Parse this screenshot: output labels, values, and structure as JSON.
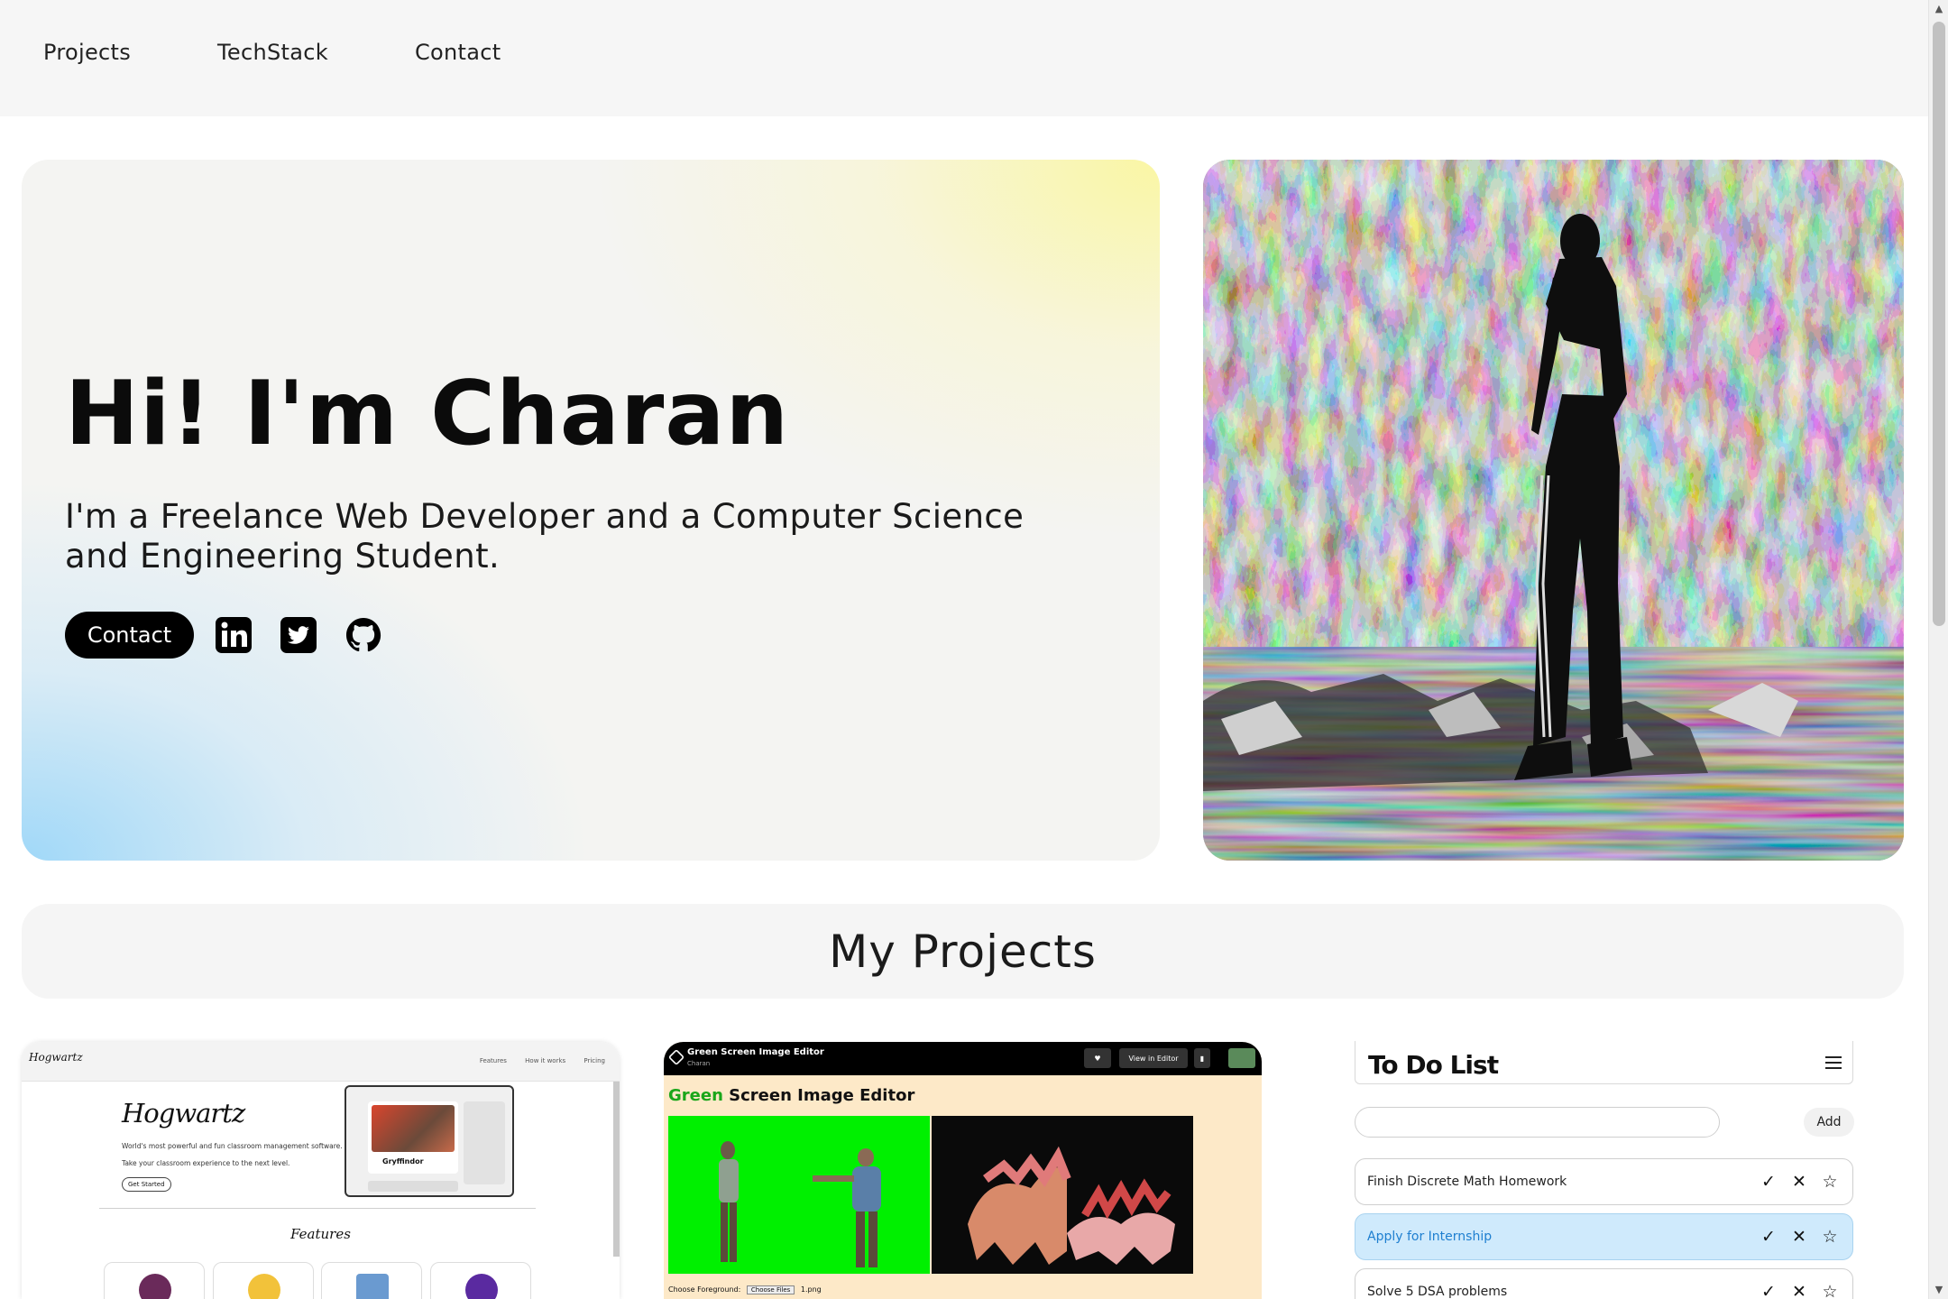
{
  "nav": {
    "items": [
      "Projects",
      "TechStack",
      "Contact"
    ]
  },
  "hero": {
    "heading": "Hi! I'm Charan",
    "tagline": "I'm a Freelance Web Developer and a Computer Science and Engineering Student.",
    "contact_label": "Contact",
    "social_icons": [
      "linkedin-icon",
      "twitter-icon",
      "github-icon"
    ]
  },
  "projects": {
    "title": "My Projects",
    "hogwartz": {
      "logo": "Hogwartz",
      "nav_links": [
        "Features",
        "How it works",
        "Pricing"
      ],
      "title": "Hogwartz",
      "subtitle": "World's most powerful and fun classroom management software.",
      "subtitle2": "Take your classroom experience to the next level.",
      "cta": "Get Started",
      "house": "Gryffindor",
      "features_heading": "Features"
    },
    "green_screen": {
      "app_title": "Green Screen Image Editor",
      "app_author": "Charan",
      "view_button": "View in Editor",
      "heading_green": "Green",
      "heading_rest": " Screen Image Editor",
      "foreground_label": "Choose Foreground:",
      "choose_files": "Choose Files",
      "file_name": "1.png"
    },
    "todo": {
      "title": "To Do List",
      "add_label": "Add",
      "input_value": "",
      "items": [
        {
          "text": "Finish Discrete Math Homework",
          "active": false
        },
        {
          "text": "Apply for Internship",
          "active": true
        },
        {
          "text": "Solve 5 DSA problems",
          "active": false
        }
      ]
    }
  },
  "colors": {
    "hero_yellow": "#faf6a0",
    "hero_blue": "#a0d8f8",
    "todo_active": "#cfeafc",
    "todo_active_text": "#1e7fd0"
  }
}
